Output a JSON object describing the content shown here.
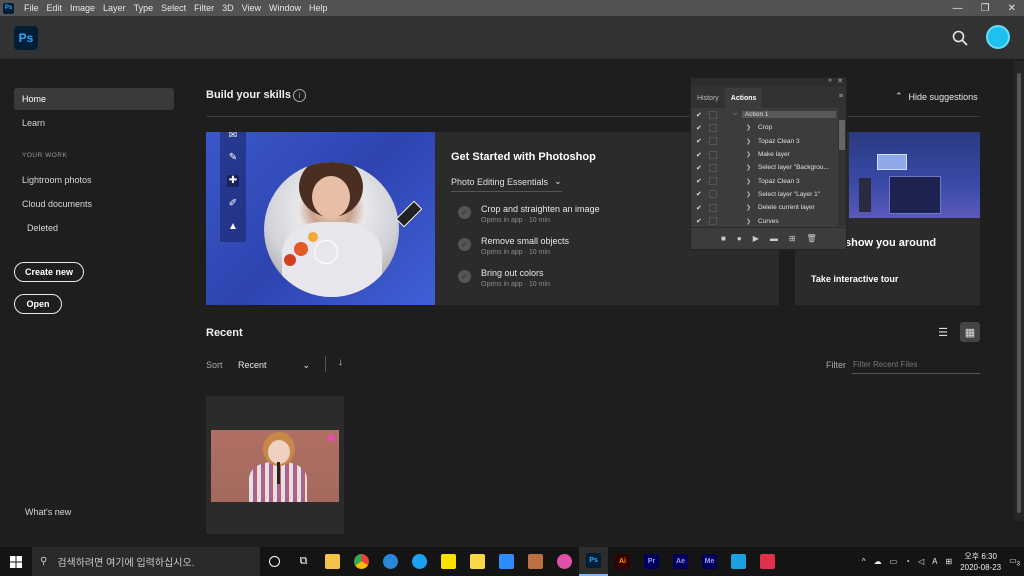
{
  "menubar": {
    "app_icon": "Ps",
    "items": [
      "File",
      "Edit",
      "Image",
      "Layer",
      "Type",
      "Select",
      "Filter",
      "3D",
      "View",
      "Window",
      "Help"
    ],
    "controls": [
      "—",
      "❐",
      "✕"
    ]
  },
  "topbar": {
    "logo": "Ps"
  },
  "sidebar": {
    "home": "Home",
    "learn": "Learn",
    "your_work_heading": "YOUR WORK",
    "lightroom": "Lightroom photos",
    "cloud": "Cloud documents",
    "deleted": "Deleted",
    "create_new": "Create new",
    "open": "Open",
    "whats_new": "What's new"
  },
  "skills": {
    "title": "Build your skills",
    "info_icon": "i",
    "hide": "Hide suggestions",
    "card_title": "Get Started with Photoshop",
    "dropdown": "Photo Editing Essentials",
    "tasks": [
      {
        "title": "Crop and straighten an image",
        "sub": "Opens in app · 10 min"
      },
      {
        "title": "Remove small objects",
        "sub": "Opens in app · 10 min"
      },
      {
        "title": "Bring out colors",
        "sub": "Opens in app · 10 min"
      }
    ],
    "tour_title": "show you around",
    "tour_link": "Take interactive tour"
  },
  "recent": {
    "title": "Recent",
    "sort_label": "Sort",
    "sort_value": "Recent",
    "filter_label": "Filter",
    "filter_placeholder": "Filter Recent Files"
  },
  "actions_panel": {
    "tabs": [
      "History",
      "Actions"
    ],
    "rows": [
      "Action 1",
      "Crop",
      "Topaz Clean 3",
      "Make layer",
      "Select layer \"Backgrou...",
      "Topaz Clean 3",
      "Select layer \"Layer 1\"",
      "Delete current layer",
      "Curves"
    ]
  },
  "taskbar": {
    "search_placeholder": "검색하려면 여기에 입력하십시오.",
    "apps": [
      {
        "label": "Ps",
        "color": "#31a8ff",
        "bg": "#001e36"
      },
      {
        "label": "Ai",
        "color": "#ff9a00",
        "bg": "#330000"
      },
      {
        "label": "Pr",
        "color": "#9999ff",
        "bg": "#00005b"
      },
      {
        "label": "Ae",
        "color": "#9999ff",
        "bg": "#00005b"
      },
      {
        "label": "Me",
        "color": "#9999ff",
        "bg": "#00005b"
      }
    ],
    "ime": "A",
    "time": "오후 6:30",
    "date": "2020-08-23",
    "notifications": "3"
  }
}
